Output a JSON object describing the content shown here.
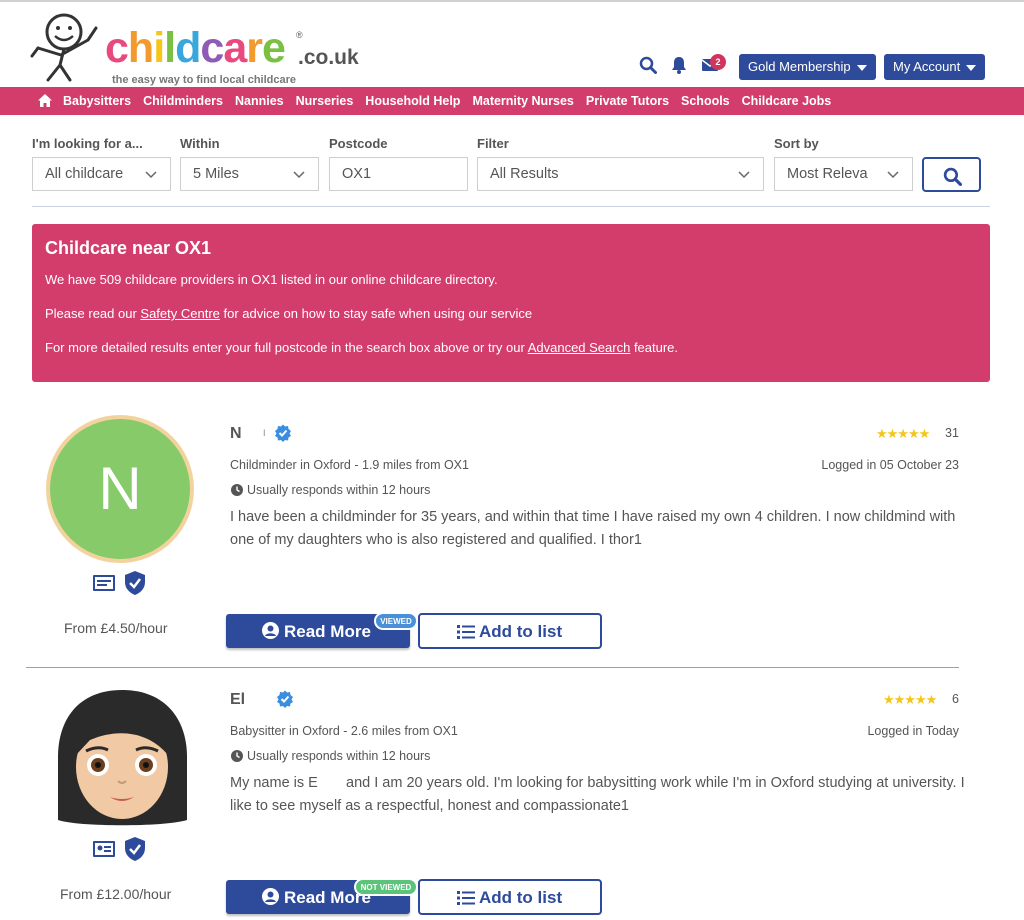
{
  "header": {
    "logo_text": "childcare",
    "logo_tld": ".co.uk",
    "logo_reg": "®",
    "logo_tagline": "the easy way to find local childcare",
    "notification_count": "2",
    "gold_membership_label": "Gold Membership",
    "my_account_label": "My Account"
  },
  "nav": {
    "items": [
      "Babysitters",
      "Childminders",
      "Nannies",
      "Nurseries",
      "Household Help",
      "Maternity Nurses",
      "Private Tutors",
      "Schools",
      "Childcare Jobs"
    ]
  },
  "search": {
    "looking_for_label": "I'm looking for a...",
    "looking_for_value": "All childcare",
    "within_label": "Within",
    "within_value": "5 Miles",
    "postcode_label": "Postcode",
    "postcode_value": "OX1",
    "filter_label": "Filter",
    "filter_value": "All Results",
    "sort_label": "Sort by",
    "sort_value": "Most Releva"
  },
  "info": {
    "title": "Childcare near OX1",
    "line1": "We have 509 childcare providers in OX1 listed in our online childcare directory.",
    "line2_pre": "Please read our ",
    "line2_link": "Safety Centre",
    "line2_post": " for advice on how to stay safe when using our service",
    "line3_pre": "For more detailed results enter your full postcode in the search box above or try our ",
    "line3_link": "Advanced Search",
    "line3_post": " feature."
  },
  "listings": [
    {
      "avatar_letter": "N",
      "name": "N",
      "name_suffix": "I",
      "type_location": "Childminder in Oxford - 1.9 miles from OX1",
      "logged_in": "Logged in 05 October 23",
      "responds": "Usually responds within 12 hours",
      "rating_stars": "★★★★★",
      "review_count": "31",
      "description": "I have been a childminder for 35 years, and within that time I have raised my own 4 children. I now childmind with one of my daughters who is also registered and qualified. I thor1",
      "price": "From £4.50/hour",
      "read_more_label": "Read More",
      "add_to_list_label": "Add to list",
      "viewed_tag": "VIEWED"
    },
    {
      "name": "El",
      "type_location": "Babysitter in Oxford - 2.6 miles from OX1",
      "logged_in": "Logged in Today",
      "responds": "Usually responds within 12 hours",
      "rating_stars": "★★★★★",
      "review_count": "6",
      "description": "My name is E       and I am 20 years old. I'm looking for babysitting work while I'm in Oxford studying at university. I like to see myself as a respectful, honest and compassionate1",
      "price": "From £12.00/hour",
      "read_more_label": "Read More",
      "add_to_list_label": "Add to list",
      "viewed_tag": "NOT VIEWED"
    }
  ],
  "colors": {
    "brand_pink": "#d33d6c",
    "brand_blue": "#2e4b9b",
    "star_gold": "#f5c518",
    "verified_blue": "#3b8de0",
    "viewed_tag": "#4a90d9",
    "not_viewed_tag": "#5cc47a"
  }
}
